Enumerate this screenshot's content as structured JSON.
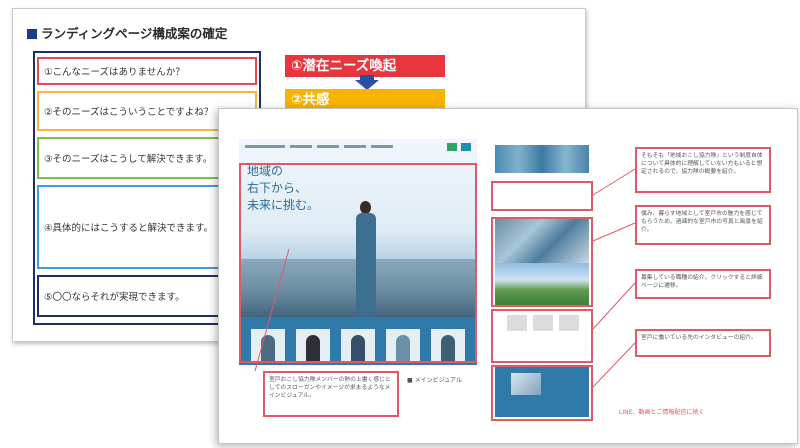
{
  "back_slide": {
    "title": "ランディングページ構成案の確定",
    "items": [
      {
        "text": "①こんなニーズはありませんか？",
        "color": "#e04a5a"
      },
      {
        "text": "②そのニーズはこういうことですよね？",
        "color": "#f5b642"
      },
      {
        "text": "③そのニーズはこうして解決できます。",
        "color": "#7ac04b"
      },
      {
        "text": "④具体的にはこうすると解決できます。",
        "color": "#3a9ee0"
      },
      {
        "text": "⑤〇〇ならそれが実現できます。",
        "color": "#1e2f66"
      }
    ],
    "steps": [
      {
        "text": "①潜在ニーズ喚起",
        "color": "#e8363f"
      },
      {
        "text": "②共感",
        "color": "#f7b400"
      }
    ]
  },
  "front_slide": {
    "hero_copy": [
      "地域の",
      "右下から、",
      "未来に挑む。"
    ],
    "notes": [
      "そもそも「地域おこし協力隊」という制度自体について具体的に理解していない方もいると想定されるので、協力隊の概要を紹介。",
      "僕み、暮らす地域として室戸市の魅力を感じてもらうため、過疎的な室戸市の写真と風景を紹介。",
      "募集している職種の紹介。クリックすると詳細ページに遷移。",
      "室戸に働いている先のインタビューの紹介。",
      "室戸おこし協力隊メンバーの熱の上書く感じとしてのスローガンやイメージが求まるようなメインビジュアル。"
    ],
    "main_visual_label": "メインビジュアル",
    "bottom_link": "LINE、動画とご情報配信に続く"
  }
}
